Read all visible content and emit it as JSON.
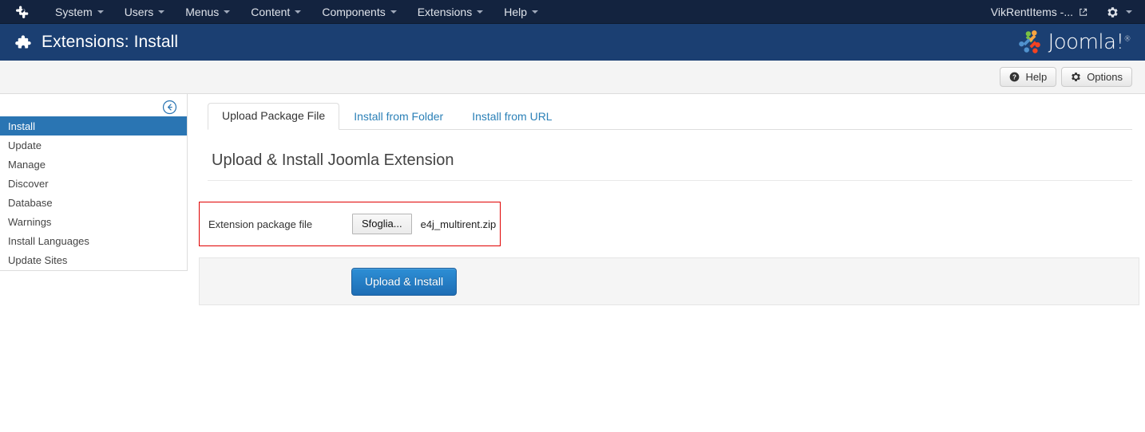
{
  "topbar": {
    "brand_icon": "joomla-mark-icon",
    "menu": [
      {
        "label": "System",
        "has_caret": true
      },
      {
        "label": "Users",
        "has_caret": true
      },
      {
        "label": "Menus",
        "has_caret": true
      },
      {
        "label": "Content",
        "has_caret": true
      },
      {
        "label": "Components",
        "has_caret": true
      },
      {
        "label": "Extensions",
        "has_caret": true
      },
      {
        "label": "Help",
        "has_caret": true
      }
    ],
    "site_name": "VikRentItems -...",
    "site_link_icon": "external-link-icon",
    "settings_icon": "gear-icon",
    "settings_caret": true
  },
  "header": {
    "icon": "puzzle-piece-icon",
    "title": "Extensions: Install",
    "logo_text": "Joomla!",
    "logo_registered": "®"
  },
  "toolbar": {
    "help_label": "Help",
    "help_icon": "question-circle-icon",
    "options_label": "Options",
    "options_icon": "gear-icon"
  },
  "sidebar": {
    "collapse_icon": "arrow-circle-left-icon",
    "items": [
      {
        "label": "Install",
        "active": true
      },
      {
        "label": "Update",
        "active": false
      },
      {
        "label": "Manage",
        "active": false
      },
      {
        "label": "Discover",
        "active": false
      },
      {
        "label": "Database",
        "active": false
      },
      {
        "label": "Warnings",
        "active": false
      },
      {
        "label": "Install Languages",
        "active": false
      },
      {
        "label": "Update Sites",
        "active": false
      }
    ]
  },
  "main": {
    "tabs": [
      {
        "label": "Upload Package File",
        "active": true
      },
      {
        "label": "Install from Folder",
        "active": false
      },
      {
        "label": "Install from URL",
        "active": false
      }
    ],
    "panel_title": "Upload & Install Joomla Extension",
    "upload": {
      "field_label": "Extension package file",
      "browse_button": "Sfoglia...",
      "file_name": "e4j_multirent.zip"
    },
    "submit_label": "Upload & Install"
  },
  "colors": {
    "topbar_bg": "#13233f",
    "header_bg": "#1b3f72",
    "accent_blue": "#2a75b3",
    "link_blue": "#2b80b7",
    "error_red": "#e00000",
    "primary_button": "#1e6eb5",
    "subhead_bg": "#f4f4f4",
    "panel_bg": "#f5f5f5"
  }
}
